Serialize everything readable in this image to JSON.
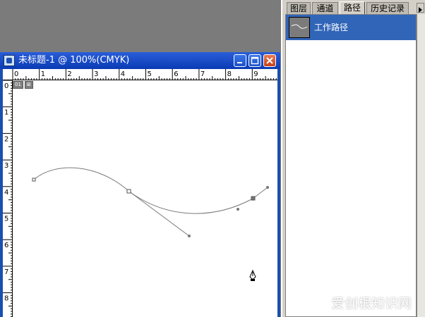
{
  "document": {
    "title": "未标题-1 @ 100%(CMYK)",
    "ruler_h": [
      "0",
      "1",
      "2",
      "3",
      "4",
      "5",
      "6",
      "7",
      "8",
      "9"
    ],
    "ruler_v": [
      "0",
      "1",
      "2",
      "3",
      "4",
      "5",
      "6",
      "7",
      "8"
    ],
    "tools": [
      "01",
      "⊞"
    ]
  },
  "panel": {
    "tabs": [
      "图层",
      "通道",
      "路径",
      "历史记录"
    ],
    "active_tab": "路径",
    "paths": [
      {
        "name": "工作路径",
        "selected": true
      }
    ]
  },
  "watermark": "爱创根知识网",
  "colors": {
    "selection": "#3165b8",
    "titlebar": "#2058d0",
    "workspace": "#7b7b7b"
  }
}
